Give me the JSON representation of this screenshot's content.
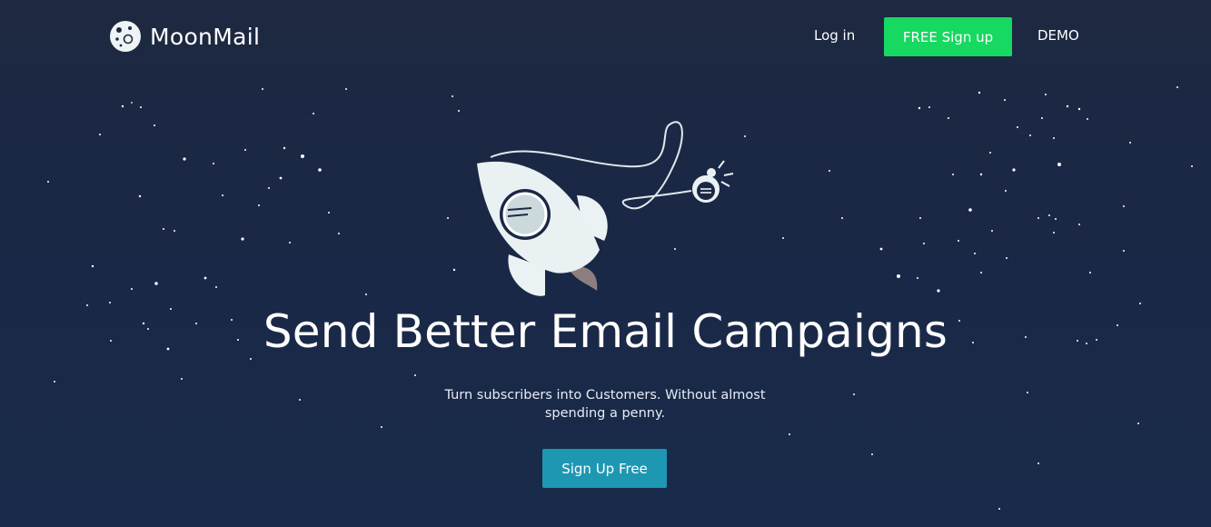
{
  "brand": {
    "name": "MoonMail",
    "icon": "moon-icon"
  },
  "nav": {
    "login_label": "Log in",
    "signup_label": "FREE Sign up",
    "demo_label": "DEMO"
  },
  "hero": {
    "title": "Send Better Email Campaigns",
    "subtitle": "Turn subscribers into Customers. Without almost spending a penny.",
    "cta_label": "Sign Up Free",
    "illustration": "rocket-with-astronaut"
  },
  "colors": {
    "background": "#1a2846",
    "signup_green": "#17d860",
    "cta_teal": "#1e97b3",
    "text": "#ffffff"
  }
}
